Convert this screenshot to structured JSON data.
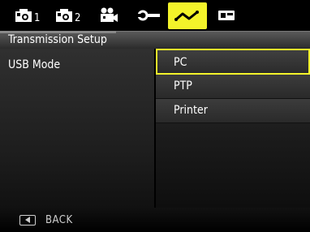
{
  "tabs": [
    {
      "icon": "camera-icon",
      "num": "1"
    },
    {
      "icon": "camera-icon",
      "num": "2"
    },
    {
      "icon": "video-camera-icon",
      "num": ""
    },
    {
      "icon": "wrench-icon",
      "num": ""
    },
    {
      "icon": "transmission-icon",
      "num": "",
      "active": true
    },
    {
      "icon": "playback-icon",
      "num": ""
    }
  ],
  "header": {
    "title": "Transmission Setup"
  },
  "setting": {
    "label": "USB Mode"
  },
  "options": [
    "PC",
    "PTP",
    "Printer"
  ],
  "selected": "PC",
  "footer": {
    "back_label": "BACK"
  },
  "colors": {
    "accent": "#f3f32a"
  }
}
